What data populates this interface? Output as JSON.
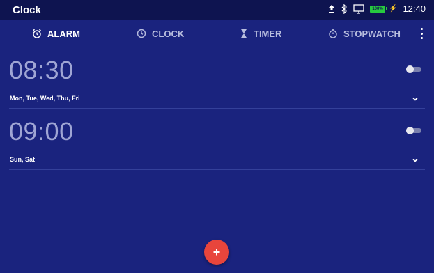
{
  "app": {
    "title": "Clock"
  },
  "status": {
    "battery": "100%",
    "time": "12:40",
    "icons": [
      "upload-icon",
      "bluetooth-icon",
      "desktop-icon",
      "battery-icon",
      "charging-icon"
    ]
  },
  "tabs": [
    {
      "label": "ALARM",
      "icon": "alarm-icon",
      "active": true
    },
    {
      "label": "CLOCK",
      "icon": "clock-icon",
      "active": false
    },
    {
      "label": "TIMER",
      "icon": "hourglass-icon",
      "active": false
    },
    {
      "label": "STOPWATCH",
      "icon": "stopwatch-icon",
      "active": false
    }
  ],
  "alarms": [
    {
      "time": "08:30",
      "days": "Mon, Tue, Wed, Thu, Fri",
      "enabled": false
    },
    {
      "time": "09:00",
      "days": "Sun, Sat",
      "enabled": false
    }
  ],
  "fab": {
    "label": "+"
  },
  "colors": {
    "background": "#1a237e",
    "statusbar": "#0e1450",
    "fab": "#e8453c",
    "battery": "#27c93f"
  }
}
